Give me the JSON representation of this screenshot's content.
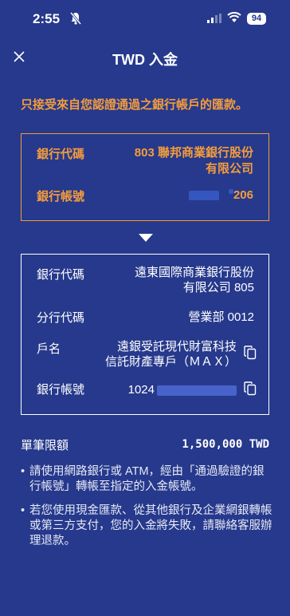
{
  "status": {
    "time": "2:55",
    "battery": "94"
  },
  "nav": {
    "title": "TWD 入金"
  },
  "warning": "只接受來自您認證通過之銀行帳戶的匯款。",
  "source_account": {
    "bank_code_label": "銀行代碼",
    "bank_code_value_line1": "803 聯邦商業銀行股份",
    "bank_code_value_line2": "有限公司",
    "account_label": "銀行帳號",
    "account_suffix": "206"
  },
  "destination_account": {
    "bank_code_label": "銀行代碼",
    "bank_code_value_line1": "遠東國際商業銀行股份",
    "bank_code_value_line2": "有限公司 805",
    "branch_label": "分行代碼",
    "branch_value": "營業部 0012",
    "holder_label": "戶名",
    "holder_value_line1": "遠銀受託現代財富科技",
    "holder_value_line2": "信託財產專戶（ＭＡＸ）",
    "account_label": "銀行帳號",
    "account_prefix": "1024"
  },
  "limit": {
    "label": "單筆限額",
    "value": "1,500,000 TWD"
  },
  "notes": [
    "請使用網路銀行或 ATM，經由「通過驗證的銀行帳號」轉帳至指定的入金帳號。",
    "若您使用現金匯款、從其他銀行及企業網銀轉帳或第三方支付，您的入金將失敗，請聯絡客服辦理退款。"
  ],
  "colors": {
    "background": "#26398c",
    "accent": "#f39c3c"
  }
}
